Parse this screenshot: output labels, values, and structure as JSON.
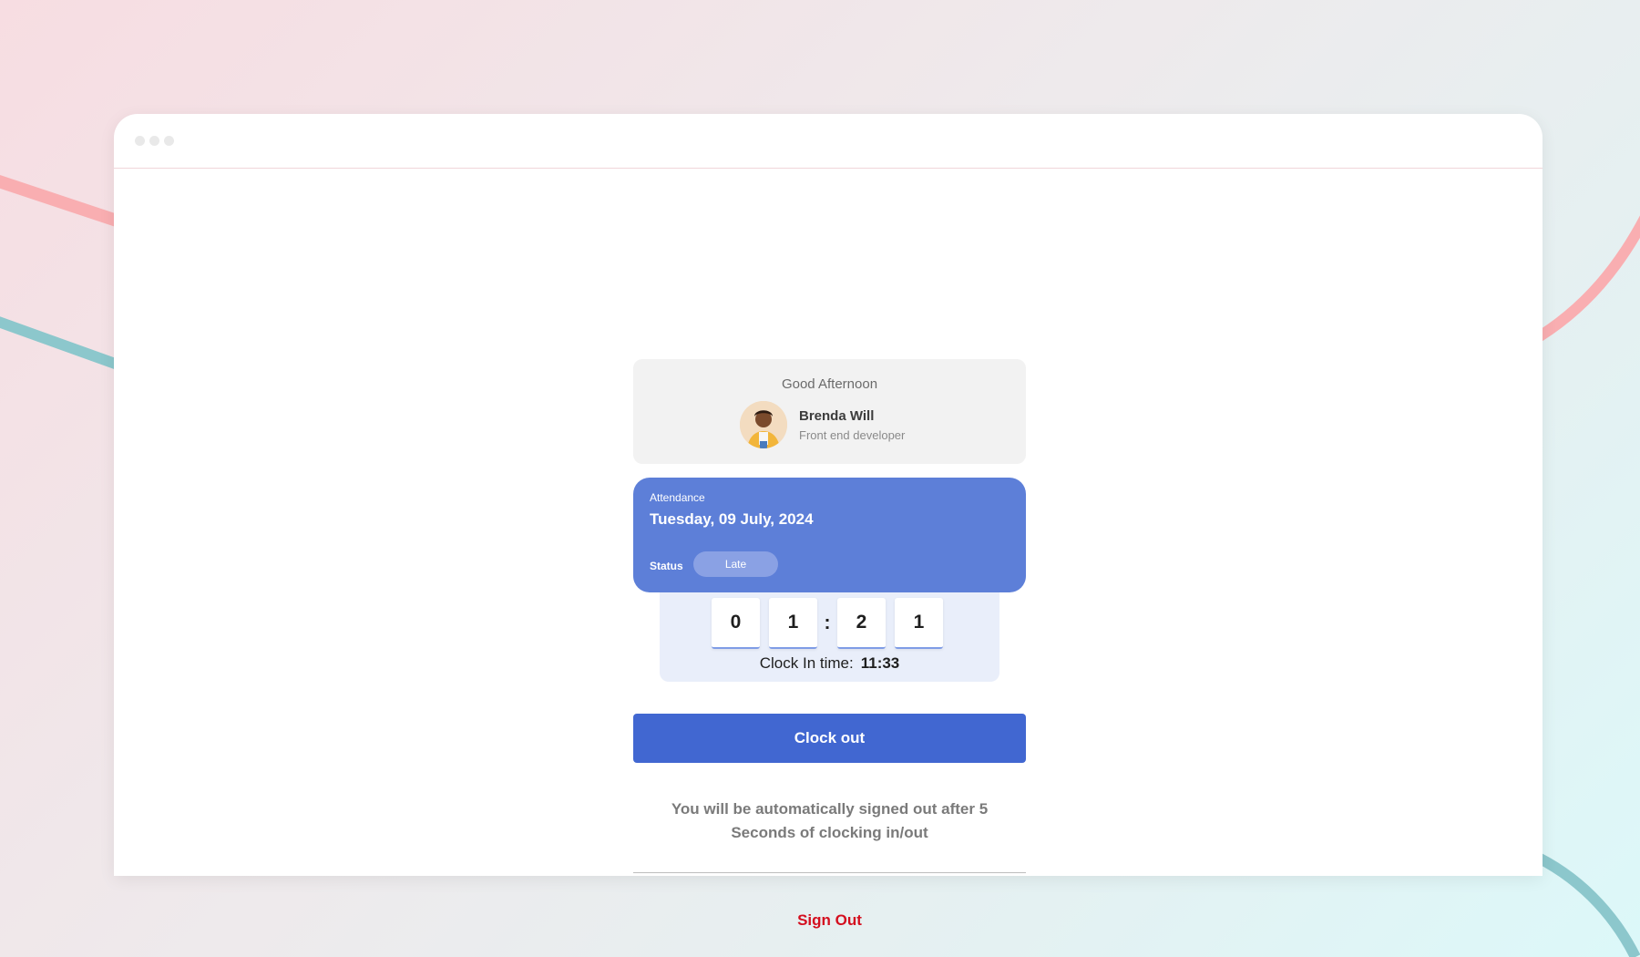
{
  "window": {
    "controls": [
      "dot",
      "dot",
      "dot"
    ]
  },
  "greeting_card": {
    "greeting": "Good Afternoon",
    "user": {
      "name": "Brenda Will",
      "role": "Front end developer",
      "avatar_icon": "user-photo-icon"
    }
  },
  "attendance": {
    "label": "Attendance",
    "date": "Tuesday, 09 July, 2024",
    "status_label": "Status",
    "status_value": "Late"
  },
  "timer": {
    "digits": [
      "0",
      "1",
      "2",
      "1"
    ],
    "separator": ":",
    "clock_in_label": "Clock In time:",
    "clock_in_time": "11:33"
  },
  "actions": {
    "clock_out_label": "Clock out",
    "auto_signout_line1": "You will be automatically signed out after 5",
    "auto_signout_line2": "Seconds of clocking in/out",
    "sign_out_label": "Sign Out"
  },
  "colors": {
    "attendance_card": "#5d7fd8",
    "status_badge": "#8aa1e4",
    "primary_button": "#4167d1",
    "timer_panel": "#e9eefa",
    "sign_out": "#d40f1f",
    "bg_line_pink": "#f9aeb1",
    "bg_line_teal": "#8cc7cc"
  }
}
